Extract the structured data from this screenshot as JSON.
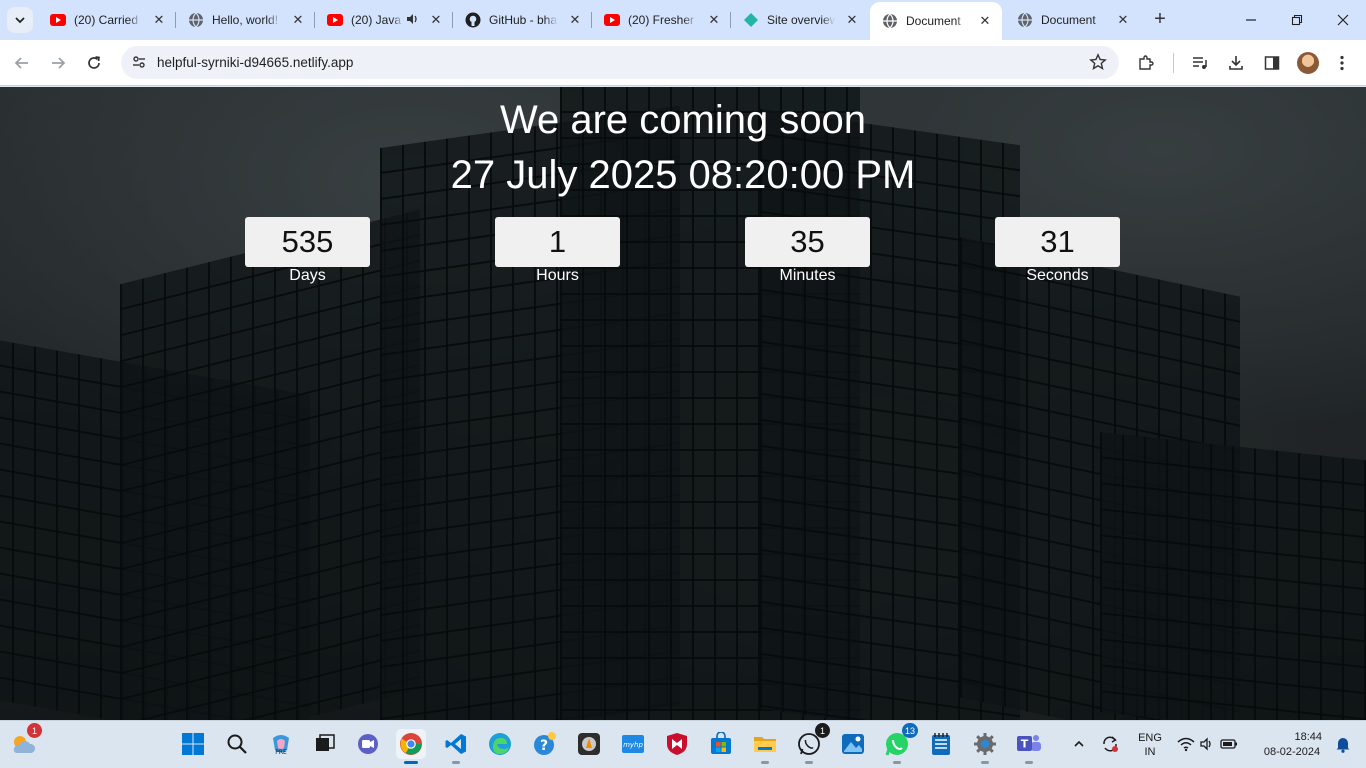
{
  "browser": {
    "tabs": [
      {
        "title": "(20) Carried",
        "favicon": "youtube-icon",
        "active": false
      },
      {
        "title": "Hello, world!",
        "favicon": "globe-icon",
        "active": false
      },
      {
        "title": "(20) Java",
        "favicon": "youtube-icon",
        "active": false,
        "audio": true
      },
      {
        "title": "GitHub - bha",
        "favicon": "github-icon",
        "active": false
      },
      {
        "title": "(20) Fresher",
        "favicon": "youtube-icon",
        "active": false
      },
      {
        "title": "Site overview",
        "favicon": "netlify-icon",
        "active": false
      },
      {
        "title": "Document",
        "favicon": "globe-icon",
        "active": true
      },
      {
        "title": "Document",
        "favicon": "globe-icon",
        "active": false
      }
    ],
    "url": "helpful-syrniki-d94665.netlify.app"
  },
  "page": {
    "heading": "We are coming soon",
    "target_date": "27 July 2025 08:20:00 PM",
    "countdown": [
      {
        "value": "535",
        "label": "Days"
      },
      {
        "value": "1",
        "label": "Hours"
      },
      {
        "value": "35",
        "label": "Minutes"
      },
      {
        "value": "31",
        "label": "Seconds"
      }
    ]
  },
  "taskbar": {
    "weather_badge": "1",
    "whatsapp_badge": "1",
    "whatsapp2_badge": "13",
    "lang_line1": "ENG",
    "lang_line2": "IN",
    "time": "18:44",
    "date": "08-02-2024"
  },
  "colors": {
    "tabstrip": "#d3e3fd",
    "youtube": "#ff0000",
    "netlify": "#25b5a8",
    "accent": "#0067c0"
  }
}
